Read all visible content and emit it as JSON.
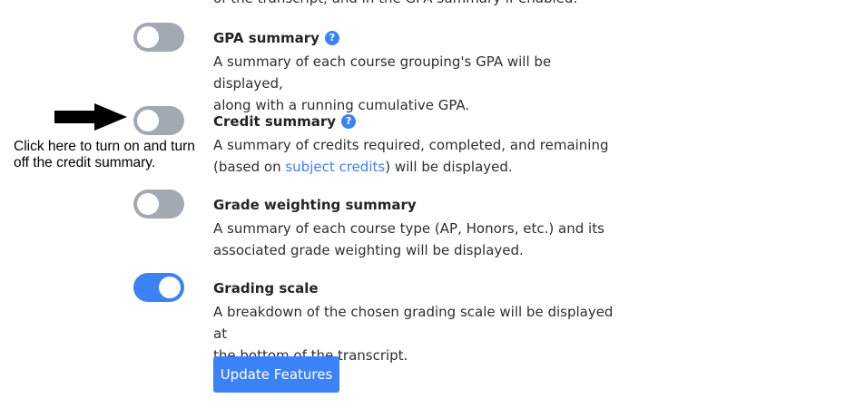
{
  "top_cut_text": "of the transcript, and in the GPA summary if enabled.",
  "features": [
    {
      "title": "GPA summary",
      "has_help": true,
      "enabled": false,
      "desc_line1": "A summary of each course grouping's GPA will be displayed,",
      "desc_line2": "along with a running cumulative GPA."
    },
    {
      "title": "Credit summary",
      "has_help": true,
      "enabled": false,
      "desc_line1": "A summary of credits required, completed, and remaining",
      "desc_prefix": "(based on ",
      "desc_link": "subject credits",
      "desc_suffix": ") will be displayed."
    },
    {
      "title": "Grade weighting summary",
      "has_help": false,
      "enabled": false,
      "desc_line1": "A summary of each course type (AP, Honors, etc.) and its",
      "desc_line2": "associated grade weighting will be displayed."
    },
    {
      "title": "Grading scale",
      "has_help": false,
      "enabled": true,
      "desc_line1": "A breakdown of the chosen grading scale will be displayed at",
      "desc_line2": "the bottom of the transcript."
    }
  ],
  "help_icon_glyph": "?",
  "annotation": {
    "line1": "Click here to turn on and turn",
    "line2": "off the credit summary."
  },
  "update_button_label": "Update Features",
  "colors": {
    "accent": "#3b82f6",
    "toggle_off": "#a3a9b1"
  }
}
